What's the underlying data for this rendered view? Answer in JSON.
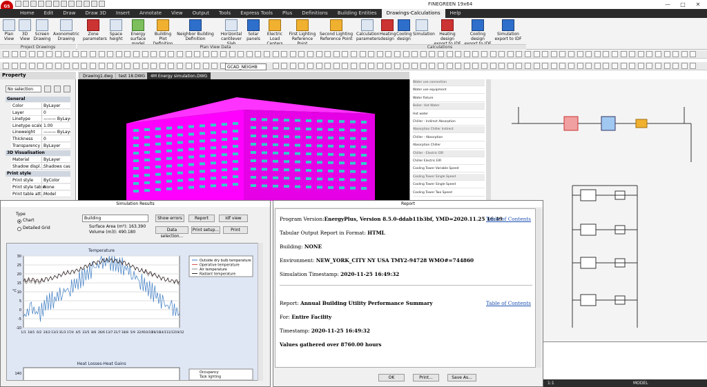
{
  "app": {
    "title": "FINEGREEN 19x64",
    "logo": "GS"
  },
  "menu": {
    "tabs": [
      "Home",
      "Edit",
      "Draw",
      "Draw 3D",
      "Insert",
      "Annotate",
      "View",
      "Output",
      "Tools",
      "Express Tools",
      "Plus",
      "Definitions",
      "Building Entities",
      "Drawings-Calculations",
      "Help"
    ],
    "active": "Drawings-Calculations"
  },
  "ribbon": {
    "buttons": [
      "Plan\nView",
      "3D\nView",
      "Screen\nDrawing",
      "Axonometric\nDrawing",
      "Zone\nparameters",
      "Space\nheight",
      "Energy\nsurface model",
      "Building Plot\nDefinition",
      "Neighbor Building\nDefinition",
      "Horizontal\ncantilever Slab",
      "Solar\npanels",
      "Electric Load\nCenters",
      "First Lighting\nReference Point",
      "Second Lighting\nReference Point",
      "Calculation\nparameters",
      "Heating\ndesign",
      "Cooling\ndesign",
      "Simulation",
      "Heating design\nexport to IDF",
      "Cooling design\nexport to IDF",
      "Simulation\nexport to IDF"
    ],
    "groups": [
      "Project Drawings",
      "Plan View Data",
      "Calculations"
    ]
  },
  "toolbar": {
    "layer": "GCAD_NEIGHB"
  },
  "doc_tabs": [
    "Drawing1.dwg",
    "test 18.DWG",
    "4M Energy simulation.DWG"
  ],
  "property": {
    "title": "Property",
    "selection": "No selection",
    "sections": [
      {
        "name": "General",
        "rows": [
          [
            "Color",
            "ByLayer"
          ],
          [
            "Layer",
            "0"
          ],
          [
            "Linetype",
            "——— ByLayer"
          ],
          [
            "Linetype scale",
            "1.00"
          ],
          [
            "Lineweight",
            "——— ByLayer"
          ],
          [
            "Thickness",
            "0"
          ],
          [
            "Transparency",
            "ByLayer"
          ]
        ]
      },
      {
        "name": "3D Visualisation",
        "rows": [
          [
            "Material",
            "ByLayer"
          ],
          [
            "Shadow displ...",
            "Shadows cas..."
          ]
        ]
      },
      {
        "name": "Print style",
        "rows": [
          [
            "Print style",
            "ByColor"
          ],
          [
            "Print style table",
            "None"
          ],
          [
            "Print table att...",
            "Model"
          ]
        ]
      }
    ]
  },
  "schematic_list": [
    "Water use connection",
    "Water use equipment",
    "Water fixture",
    "Boiler: Hot Water",
    "Hot water",
    "Chiller - Indirect Absorption",
    "Absorption Chiller Indirect",
    "Chiller - Absorption",
    "Absorption Chiller",
    "Chiller - Electric EIR",
    "Chiller Electric EIR",
    "Cooling Tower Variable Speed",
    "Cooling Tower Single Speed",
    "Cooling Tower Single Speed",
    "Cooling Tower Two Speed"
  ],
  "simulation": {
    "title": "Simulation Results",
    "type_label": "Type",
    "options": [
      "Chart",
      "Detailed Grid"
    ],
    "building": "Building",
    "surface": "Surface Area (m²): 163.390",
    "volume": "Volume (m3): 490.180",
    "buttons": [
      "Show errors",
      "Report",
      "Idf view",
      "Data selection...",
      "Print setup...",
      "Print"
    ],
    "chart1_title": "Temperature",
    "chart2_title": "Heat Losses-Heat Gains",
    "legend1": [
      "Outside dry bulb temperature",
      "Operative temperature",
      "Air temperature",
      "Radiant temperature"
    ],
    "legend2": [
      "Occupancy",
      "Task lighting"
    ]
  },
  "report": {
    "title": "Report",
    "lines": [
      {
        "label": "Program Version:",
        "value": "EnergyPlus, Version 8.5.0-ddab11b3bf, YMD=2020.11.25 16:49"
      },
      {
        "label": "Tabular Output Report in Format: ",
        "value": "HTML"
      },
      {
        "label": "Building: ",
        "value": "NONE"
      },
      {
        "label": "Environment: ",
        "value": "NEW_YORK_CITY NY USA TMY2-94728 WMO#=744860"
      },
      {
        "label": "Simulation Timestamp: ",
        "value": "2020-11-25 16:49:32"
      },
      {
        "label": "Report: ",
        "value": "Annual Building Utility Performance Summary"
      },
      {
        "label": "For: ",
        "value": "Entire Facility"
      },
      {
        "label": "Timestamp: ",
        "value": "2020-11-25 16:49:32"
      },
      {
        "label": "",
        "value": "Values gathered over 8760.00 hours"
      }
    ],
    "toc": "Table of Contents",
    "buttons": [
      "OK",
      "Print...",
      "Save As..."
    ]
  },
  "status": {
    "text": "MODEL",
    "scale": "1:1"
  },
  "chart_data": [
    {
      "type": "line",
      "title": "Temperature",
      "x": [
        "1/1",
        "18/1",
        "6/2",
        "24/2",
        "13/3",
        "31/3",
        "17/4",
        "4/5",
        "22/5",
        "8/6",
        "26/6",
        "13/7",
        "31/7",
        "18/8",
        "5/9",
        "22/9",
        "10/10",
        "28/10",
        "14/11",
        "1/12",
        "19/12"
      ],
      "ylabel": "°C",
      "ylim": [
        -10,
        30
      ],
      "series": [
        {
          "name": "Outside dry bulb temperature",
          "color": "#3a7ac2",
          "values": [
            -4,
            1,
            -3,
            4,
            6,
            10,
            12,
            16,
            19,
            23,
            26,
            27,
            25,
            24,
            20,
            16,
            12,
            8,
            3,
            1,
            -2
          ]
        },
        {
          "name": "Operative temperature",
          "color": "#d9534f",
          "values": [
            16,
            17,
            16,
            17,
            18,
            20,
            21,
            22,
            24,
            26,
            27,
            28,
            27,
            26,
            24,
            22,
            21,
            19,
            17,
            16,
            16
          ]
        },
        {
          "name": "Air temperature",
          "color": "#888888",
          "values": [
            15,
            16,
            15,
            17,
            18,
            20,
            21,
            22,
            24,
            26,
            27,
            28,
            27,
            26,
            24,
            22,
            20,
            19,
            17,
            16,
            15
          ]
        },
        {
          "name": "Radiant temperature",
          "color": "#2a2a2a",
          "values": [
            16,
            17,
            16,
            17,
            18,
            20,
            21,
            22,
            24,
            26,
            27,
            28,
            27,
            26,
            24,
            22,
            21,
            19,
            17,
            16,
            16
          ]
        }
      ]
    },
    {
      "type": "bar",
      "title": "Heat Losses-Heat Gains",
      "ylim": [
        0,
        140
      ],
      "series": [
        {
          "name": "Occupancy",
          "values": []
        },
        {
          "name": "Task lighting",
          "values": []
        }
      ]
    }
  ]
}
